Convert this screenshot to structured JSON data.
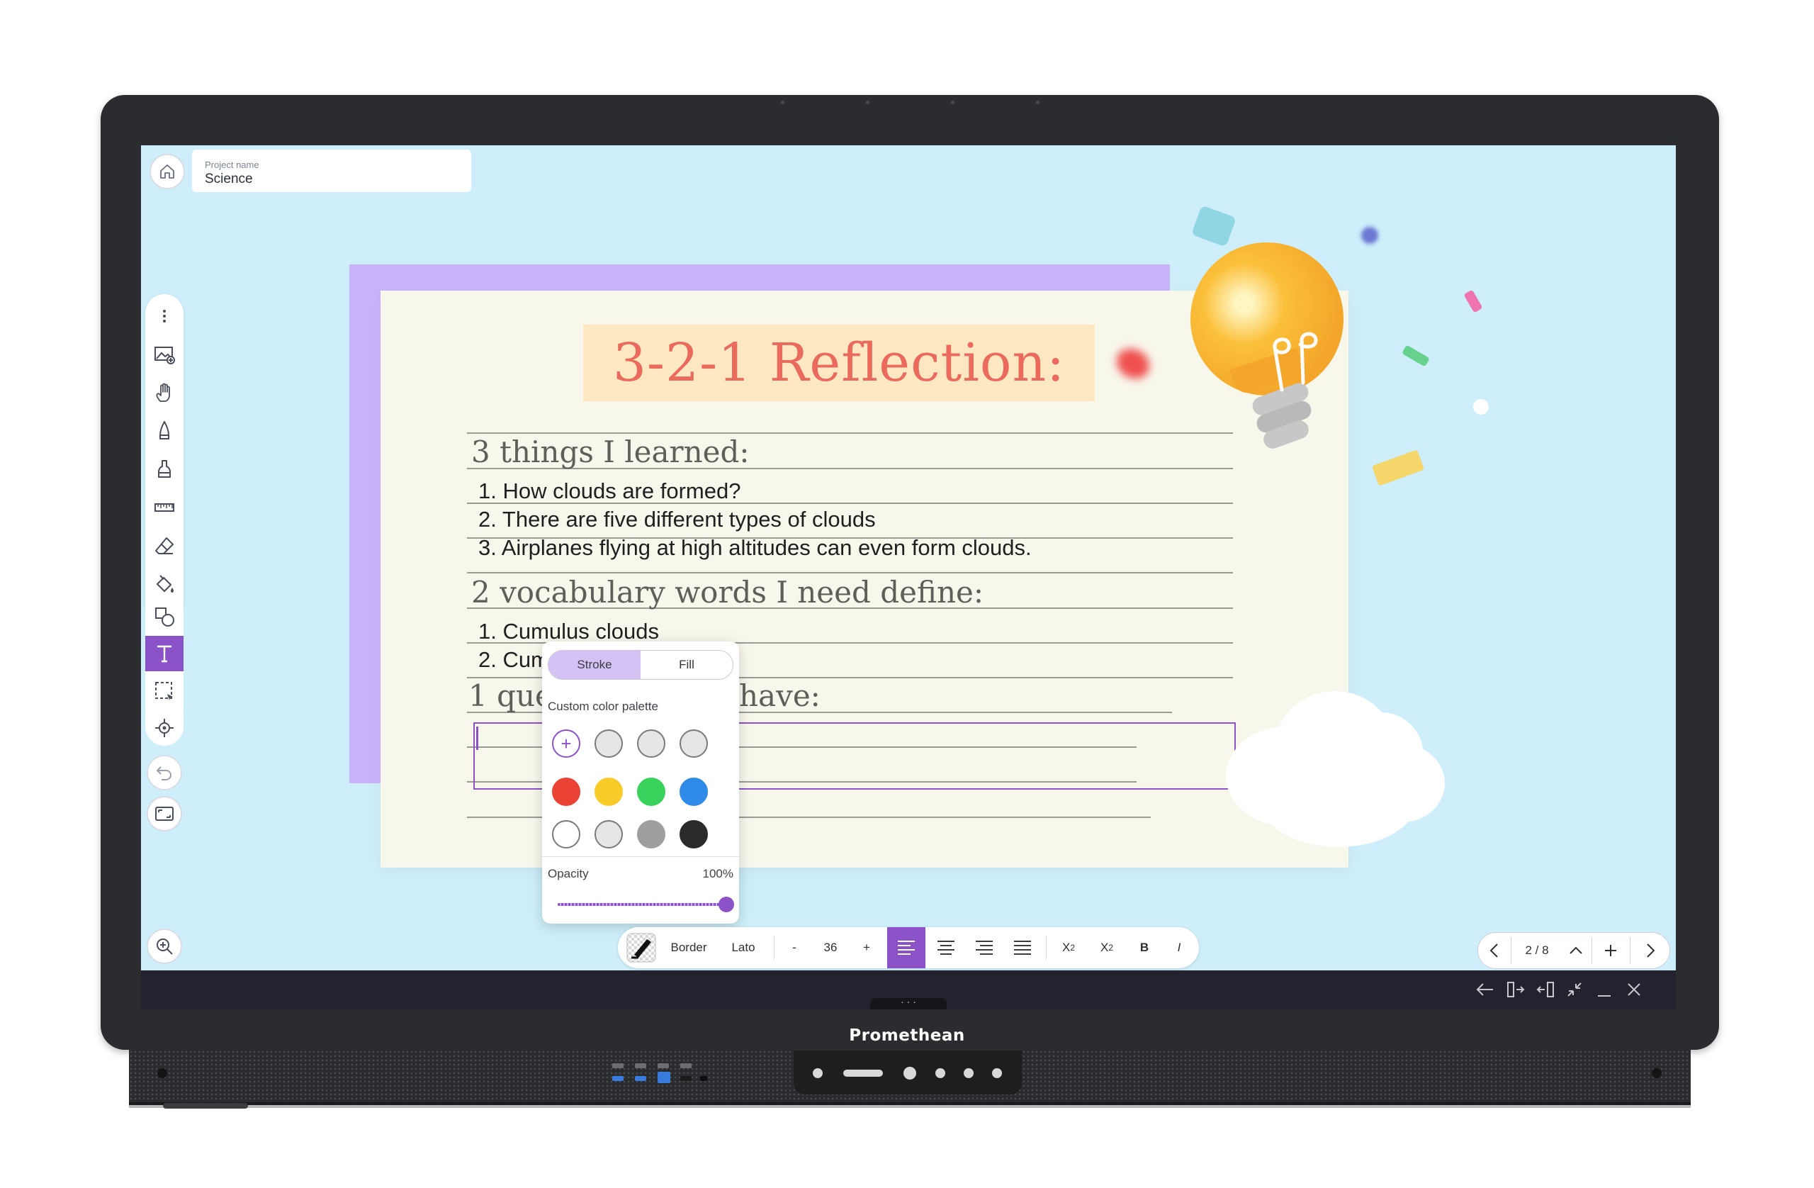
{
  "device": {
    "brand": "Promethean"
  },
  "project": {
    "label": "Project name",
    "name": "Science"
  },
  "slide": {
    "title": "3-2-1 Reflection:",
    "heading_learned": "3 things I learned:",
    "learned": [
      "1. How clouds are formed?",
      "2. There are five different types of clouds",
      "3. Airplanes flying at high altitudes can even form clouds."
    ],
    "heading_vocab": "2 vocabulary words I need define:",
    "vocab": [
      "1. Cumulus clouds",
      "2. Cum"
    ],
    "heading_question_start": "1 que",
    "heading_question_end": "have:"
  },
  "color_popup": {
    "tabs": [
      "Stroke",
      "Fill"
    ],
    "active_tab": "Stroke",
    "palette_label": "Custom color palette",
    "custom_swatches": [
      "#e6e6e6",
      "#e6e6e6",
      "#e6e6e6"
    ],
    "swatch_rows": [
      [
        "#ea4335",
        "#f9cb28",
        "#38d25c",
        "#2f8ae8"
      ],
      [
        "#ffffff",
        "#e6e6e6",
        "#9e9e9e",
        "#2b2b2b"
      ]
    ],
    "opacity_label": "Opacity",
    "opacity_value": "100%",
    "opacity": 1.0,
    "add_icon": "plus-icon"
  },
  "text_toolbar": {
    "border_label": "Border",
    "font": "Lato",
    "minus": "-",
    "size": "36",
    "plus": "+",
    "bold": "B",
    "italic": "I",
    "superscript_base": "X",
    "superscript_exp": "2",
    "subscript_base": "X",
    "subscript_sub": "2",
    "active_align": "align-left"
  },
  "pager": {
    "page": "2 / 8"
  },
  "colors": {
    "accent": "#8c52c8",
    "screen_bg": "#cdeefa",
    "title": "#ea6b5e",
    "taskbar": "#25222f"
  },
  "left_toolbar": {
    "tools": [
      "more-icon",
      "insert-image-icon",
      "hand-icon",
      "pen-icon",
      "highlighter-icon",
      "ruler-icon",
      "eraser-icon",
      "fill-icon",
      "shapes-icon",
      "text-icon",
      "selection-icon",
      "pointer-icon"
    ],
    "active": "text-icon"
  }
}
